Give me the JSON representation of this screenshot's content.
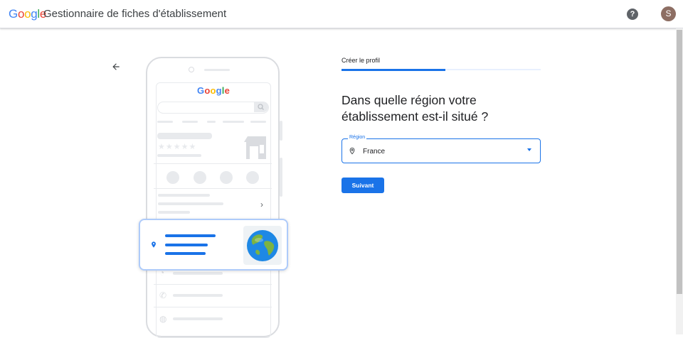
{
  "header": {
    "logo_letters": [
      {
        "char": "G",
        "color": "#4285F4"
      },
      {
        "char": "o",
        "color": "#EA4335"
      },
      {
        "char": "o",
        "color": "#FBBC05"
      },
      {
        "char": "g",
        "color": "#4285F4"
      },
      {
        "char": "l",
        "color": "#34A853"
      },
      {
        "char": "e",
        "color": "#EA4335"
      }
    ],
    "app_title": "Gestionnaire de fiches d'établissement",
    "help_icon": "?",
    "avatar_initial": "S"
  },
  "illustration": {
    "phone_logo": "Google",
    "card_icon": "location-pin-icon",
    "card_image": "globe-icon"
  },
  "form": {
    "step_label": "Créer le profil",
    "progress_percent": 52,
    "question": "Dans quelle région votre établissement est-il situé ?",
    "region_label": "Région",
    "region_value": "France",
    "submit_label": "Suivant"
  },
  "colors": {
    "accent": "#1a73e8",
    "accent_light": "#e8f0fe",
    "card_border": "#aecbfa"
  }
}
